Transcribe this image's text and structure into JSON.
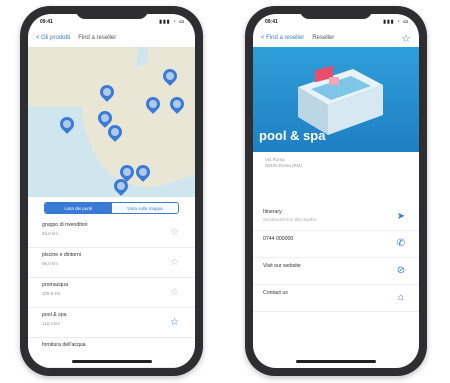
{
  "left": {
    "status_time": "09:41",
    "status_icons": "▮▮▮ ◔ ▭",
    "nav_back": "< Gli prodotti",
    "nav_title": "Find a reseller",
    "segment": [
      "Lista dei punti",
      "Vista sulla mappa"
    ],
    "resellers": [
      {
        "name": "gruppo di rivenditori",
        "distance": "82,8 km",
        "favorite": false
      },
      {
        "name": "piscine e dintorni",
        "distance": "95,0 km",
        "favorite": false
      },
      {
        "name": "promacqua",
        "distance": "108,8 km",
        "favorite": false
      },
      {
        "name": "pool & spa",
        "distance": "112,3 km",
        "favorite": true
      },
      {
        "name": "fornitura dell'acqua",
        "distance": "",
        "favorite": false
      }
    ],
    "map_pins": [
      "58",
      "63",
      "43",
      "33",
      "8"
    ]
  },
  "right": {
    "status_time": "09:41",
    "status_icons": "▮▮▮ ◔ ▭",
    "nav_back": "< Find a reseller",
    "nav_title": "Reseller",
    "brand": "pool & spa",
    "info_line1": "Via Roma",
    "info_line2": "00100 Roma (RM)",
    "menu": [
      {
        "label": "Itinerary",
        "sub": "Get directions to this reseller",
        "icon": "navigate-icon",
        "glyph": "➤"
      },
      {
        "label": "0744 000000",
        "sub": "",
        "icon": "phone-icon",
        "glyph": "✆"
      },
      {
        "label": "Visit our website",
        "sub": "",
        "icon": "globe-icon",
        "glyph": "⊘"
      },
      {
        "label": "Contact us",
        "sub": "",
        "icon": "mail-icon",
        "glyph": "⌂"
      }
    ]
  },
  "colors": {
    "accent": "#3a7bd5",
    "hero": "#2f9fd8",
    "frame": "#2e2e30"
  }
}
